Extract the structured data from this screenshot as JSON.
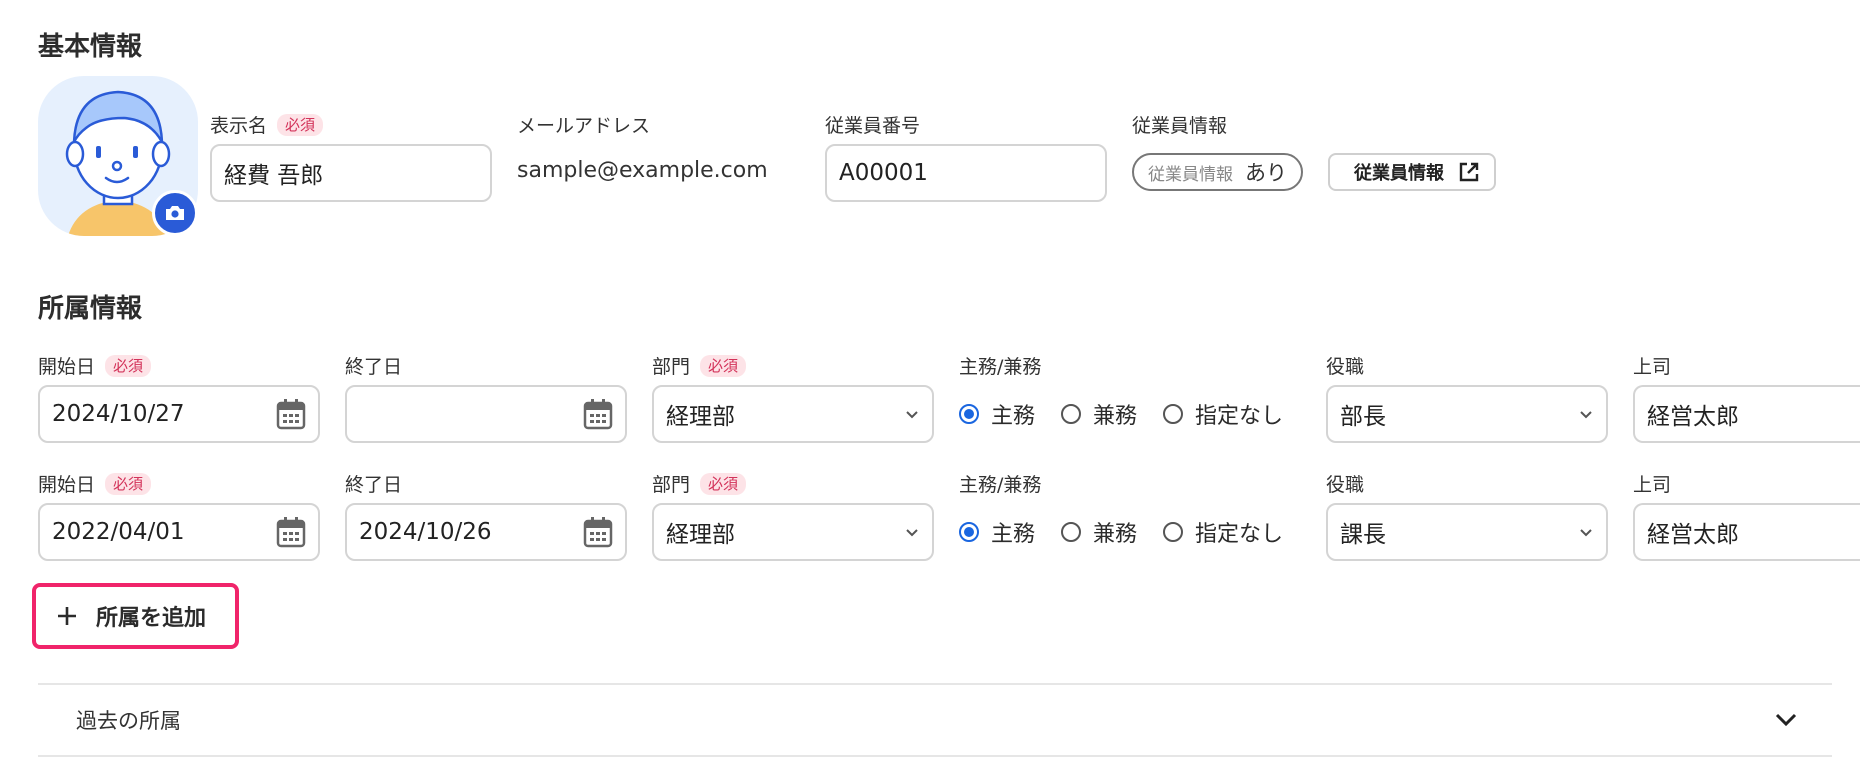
{
  "basic": {
    "section_title": "基本情報",
    "display_name": {
      "label": "表示名",
      "required": "必須",
      "value": "経費 吾郎"
    },
    "email": {
      "label": "メールアドレス",
      "value": "sample@example.com"
    },
    "employee_number": {
      "label": "従業員番号",
      "value": "A00001"
    },
    "employee_info": {
      "label": "従業員情報",
      "pill_label": "従業員情報",
      "pill_value": "あり",
      "button_label": "従業員情報"
    }
  },
  "affiliation": {
    "section_title": "所属情報",
    "rows": [
      {
        "start_label": "開始日",
        "start_required": "必須",
        "start_value": "2024/10/27",
        "end_label": "終了日",
        "end_value": "",
        "dept_label": "部門",
        "dept_required": "必須",
        "dept_value": "経理部",
        "type_label": "主務/兼務",
        "options": [
          "主務",
          "兼務",
          "指定なし"
        ],
        "selected": "主務",
        "position_label": "役職",
        "position_value": "部長",
        "boss_label": "上司",
        "boss_value": "経営太郎"
      },
      {
        "start_label": "開始日",
        "start_required": "必須",
        "start_value": "2022/04/01",
        "end_label": "終了日",
        "end_value": "2024/10/26",
        "dept_label": "部門",
        "dept_required": "必須",
        "dept_value": "経理部",
        "type_label": "主務/兼務",
        "options": [
          "主務",
          "兼務",
          "指定なし"
        ],
        "selected": "主務",
        "position_label": "役職",
        "position_value": "課長",
        "boss_label": "上司",
        "boss_value": "経営太郎"
      }
    ],
    "add_button": "所属を追加",
    "past_label": "過去の所属"
  },
  "colors": {
    "accent": "#1a66e0",
    "required_bg": "#fde3e7",
    "required_text": "#d3335a",
    "highlight": "#f0246a"
  },
  "icons": [
    "avatar",
    "camera-icon",
    "external-link-icon",
    "calendar-icon",
    "chevron-down-icon",
    "plus-icon"
  ]
}
